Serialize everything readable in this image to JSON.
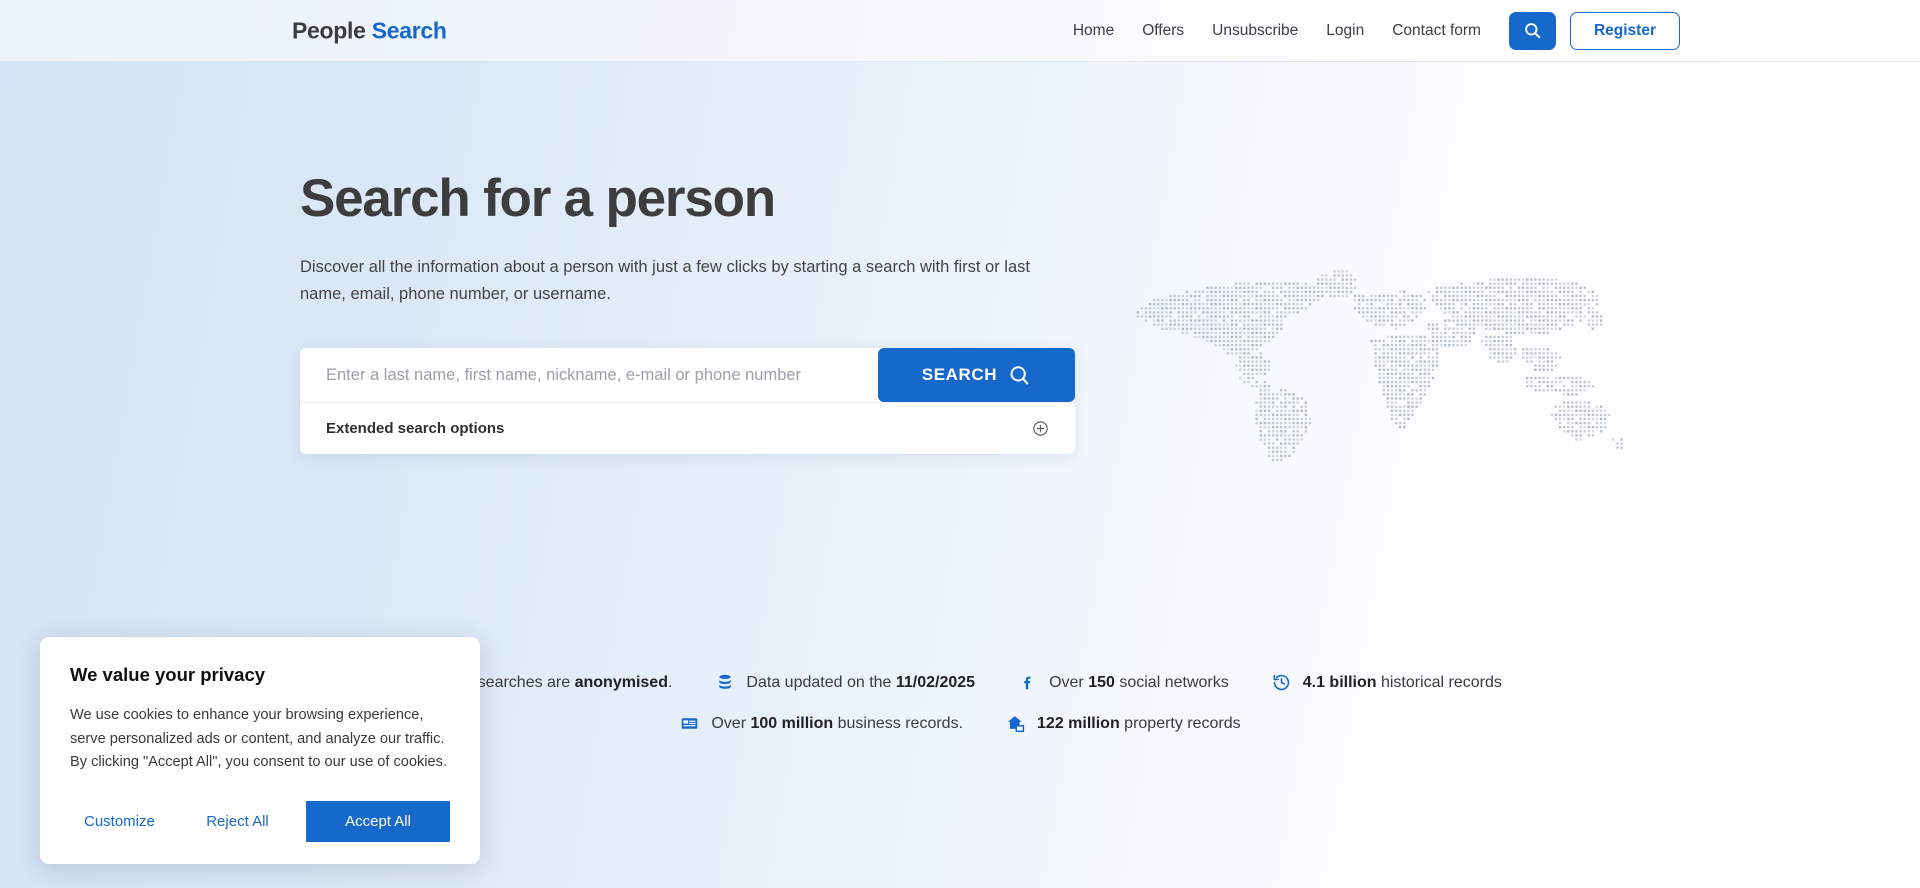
{
  "brand": {
    "name_dark": "People",
    "name_blue": "Search"
  },
  "header": {
    "nav": [
      {
        "label": "Home"
      },
      {
        "label": "Offers"
      },
      {
        "label": "Unsubscribe"
      },
      {
        "label": "Login"
      },
      {
        "label": "Contact form"
      }
    ],
    "search_icon": "search-icon",
    "register_label": "Register"
  },
  "hero": {
    "title": "Search for a person",
    "subtitle": "Discover all the information about a person with just a few clicks by starting a search with first or last name, email, phone number, or username."
  },
  "search": {
    "placeholder": "Enter a last name, first name, nickname, e-mail or phone number",
    "value": "",
    "button_label": "SEARCH",
    "button_icon": "magnifier-icon",
    "extended_label": "Extended search options",
    "extended_icon": "plus-circle-icon"
  },
  "stats": {
    "row1": [
      {
        "icon": "shield-lock-icon",
        "prefix": "our searches are ",
        "strong": "anonymised",
        "suffix": "."
      },
      {
        "icon": "database-icon",
        "prefix": "Data updated on the ",
        "strong": "11/02/2025",
        "suffix": ""
      },
      {
        "icon": "facebook-icon",
        "prefix": "Over ",
        "strong": "150",
        "suffix": " social networks"
      },
      {
        "icon": "history-icon",
        "prefix": "",
        "strong": "4.1 billion",
        "suffix": " historical records"
      }
    ],
    "row2": [
      {
        "icon": "business-card-icon",
        "prefix": "Over ",
        "strong": "100 million",
        "suffix": " business records."
      },
      {
        "icon": "property-house-icon",
        "prefix": "",
        "strong": "122 million",
        "suffix": " property records"
      }
    ]
  },
  "cookie": {
    "title": "We value your privacy",
    "body": "We use cookies to enhance your browsing experience, serve personalized ads or content, and analyze our traffic. By clicking \"Accept All\", you consent to our use of cookies.",
    "customize_label": "Customize",
    "reject_label": "Reject All",
    "accept_label": "Accept All"
  },
  "colors": {
    "accent": "#1668cb",
    "heading": "#3d3d3d",
    "bg_left": "#d3e2f4"
  }
}
